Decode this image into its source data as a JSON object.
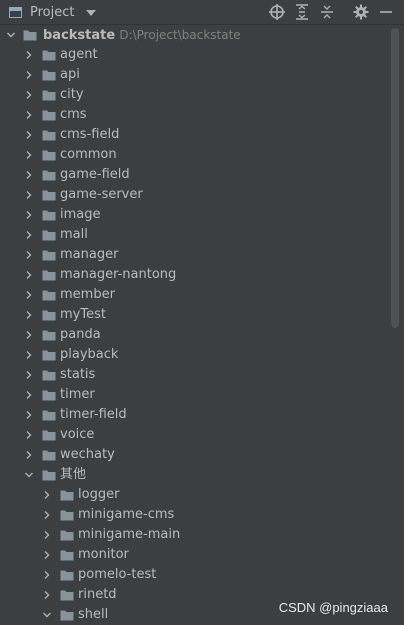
{
  "toolbar": {
    "view_label": "Project",
    "icons": [
      "crosshair-icon",
      "expand-all-icon",
      "collapse-all-icon",
      "gear-icon",
      "minimize-icon"
    ]
  },
  "root": {
    "name": "backstate",
    "path": "D:\\Project\\backstate"
  },
  "folders": [
    {
      "label": "agent"
    },
    {
      "label": "api"
    },
    {
      "label": "city"
    },
    {
      "label": "cms"
    },
    {
      "label": "cms-field"
    },
    {
      "label": "common"
    },
    {
      "label": "game-field"
    },
    {
      "label": "game-server"
    },
    {
      "label": "image"
    },
    {
      "label": "mall"
    },
    {
      "label": "manager"
    },
    {
      "label": "manager-nantong"
    },
    {
      "label": "member"
    },
    {
      "label": "myTest"
    },
    {
      "label": "panda"
    },
    {
      "label": "playback"
    },
    {
      "label": "statis"
    },
    {
      "label": "timer"
    },
    {
      "label": "timer-field"
    },
    {
      "label": "voice"
    },
    {
      "label": "wechaty"
    },
    {
      "label": "其他",
      "expanded": true
    }
  ],
  "subfolders": [
    {
      "label": "logger"
    },
    {
      "label": "minigame-cms"
    },
    {
      "label": "minigame-main"
    },
    {
      "label": "monitor"
    },
    {
      "label": "pomelo-test"
    },
    {
      "label": "rinetd"
    },
    {
      "label": "shell",
      "expanded": true
    }
  ],
  "watermark": "CSDN @pingziaaa",
  "colors": {
    "background": "#3c3f41",
    "text": "#bbbbbb",
    "folder": "#87939a",
    "path": "#808080"
  }
}
